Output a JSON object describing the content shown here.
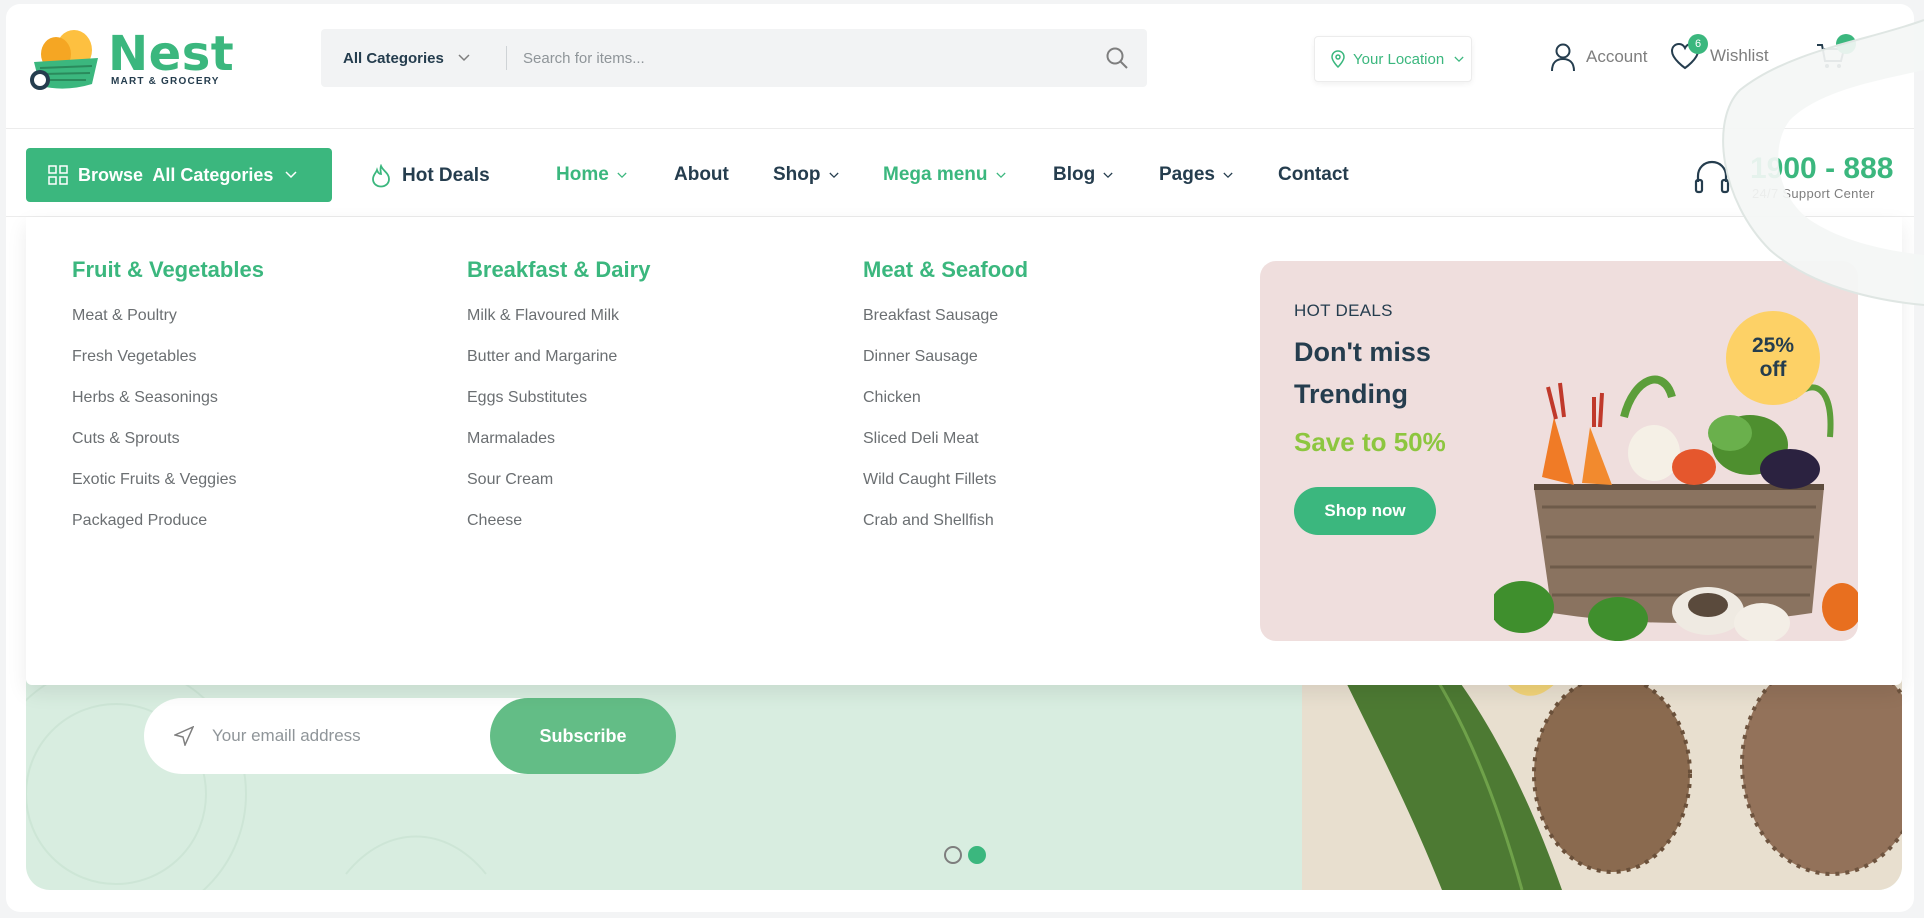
{
  "brand": {
    "name": "Nest",
    "tagline": "MART & GROCERY",
    "accent": "#3bb77e"
  },
  "search": {
    "category_label": "All Categories",
    "placeholder": "Search for items..."
  },
  "header": {
    "location_label": "Your Location",
    "account_label": "Account",
    "wishlist_label": "Wishlist",
    "wishlist_count": "6"
  },
  "nav": {
    "browse_label": "Browse  All Categories",
    "hot_deals": "Hot Deals",
    "home": "Home",
    "about": "About",
    "shop": "Shop",
    "mega_menu": "Mega menu",
    "blog": "Blog",
    "pages": "Pages",
    "contact": "Contact"
  },
  "support": {
    "number": "1900 - 888",
    "subtitle": "24/7 Support Center"
  },
  "mega_menu": {
    "columns": [
      {
        "title": "Fruit & Vegetables",
        "items": [
          "Meat & Poultry",
          "Fresh Vegetables",
          "Herbs & Seasonings",
          "Cuts & Sprouts",
          "Exotic Fruits & Veggies",
          "Packaged Produce"
        ]
      },
      {
        "title": "Breakfast & Dairy",
        "items": [
          "Milk & Flavoured Milk",
          "Butter and Margarine",
          "Eggs Substitutes",
          "Marmalades",
          "Sour Cream",
          "Cheese"
        ]
      },
      {
        "title": "Meat & Seafood",
        "items": [
          "Breakfast Sausage",
          "Dinner Sausage",
          "Chicken",
          "Sliced Deli Meat",
          "Wild Caught Fillets",
          "Crab and Shellfish"
        ]
      }
    ],
    "promo": {
      "kicker": "HOT DEALS",
      "title": "Don't miss Trending",
      "save": "Save to 50%",
      "button": "Shop now",
      "badge_value": "25%",
      "badge_suffix": "off"
    }
  },
  "newsletter": {
    "placeholder": "Your emaill address",
    "button": "Subscribe"
  },
  "slider": {
    "active_index": 2,
    "total": 2
  }
}
